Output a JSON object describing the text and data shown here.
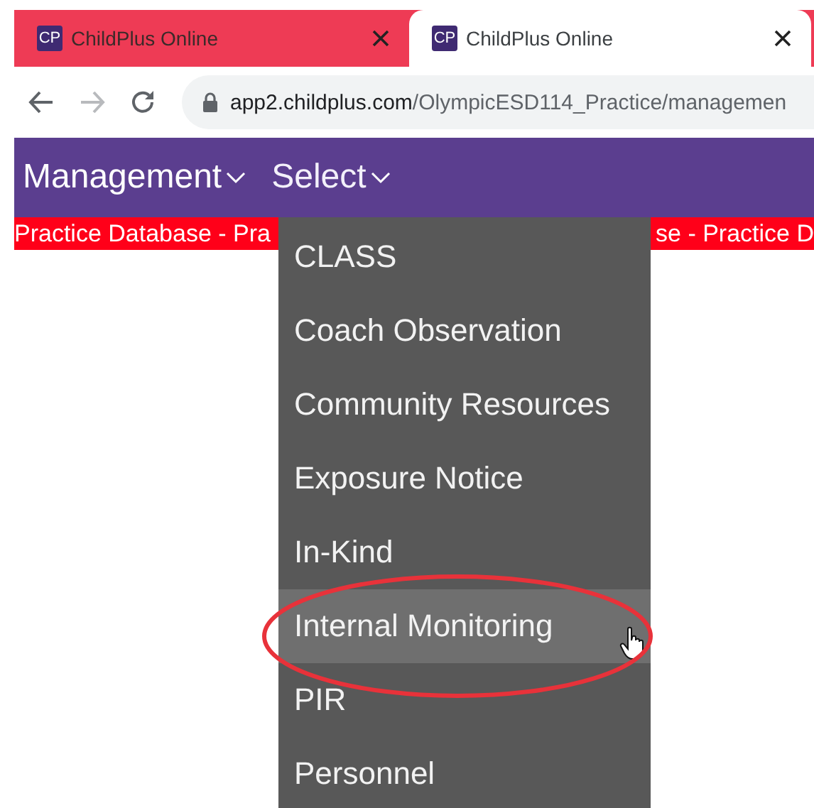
{
  "browser": {
    "tabs": [
      {
        "favicon": "CP",
        "title": "ChildPlus Online",
        "selected": false
      },
      {
        "favicon": "CP",
        "title": "ChildPlus Online",
        "selected": true
      }
    ],
    "url": {
      "host": "app2.childplus.com",
      "path": "/OlympicESD114_Practice/managemen"
    }
  },
  "nav": {
    "menus": [
      {
        "label": "Management",
        "open": false
      },
      {
        "label": "Select",
        "open": true
      }
    ]
  },
  "banner": {
    "segments": [
      "Practice Database - Pra",
      "se - Practice D"
    ]
  },
  "dropdown": {
    "items": [
      {
        "label": "CLASS",
        "selected": false,
        "circled": false
      },
      {
        "label": "Coach Observation",
        "selected": false,
        "circled": false
      },
      {
        "label": "Community Resources",
        "selected": false,
        "circled": false
      },
      {
        "label": "Exposure Notice",
        "selected": false,
        "circled": false
      },
      {
        "label": "In-Kind",
        "selected": false,
        "circled": false
      },
      {
        "label": "Internal Monitoring",
        "selected": true,
        "circled": true
      },
      {
        "label": "PIR",
        "selected": false,
        "circled": false
      },
      {
        "label": "Personnel",
        "selected": false,
        "circled": false
      }
    ]
  }
}
